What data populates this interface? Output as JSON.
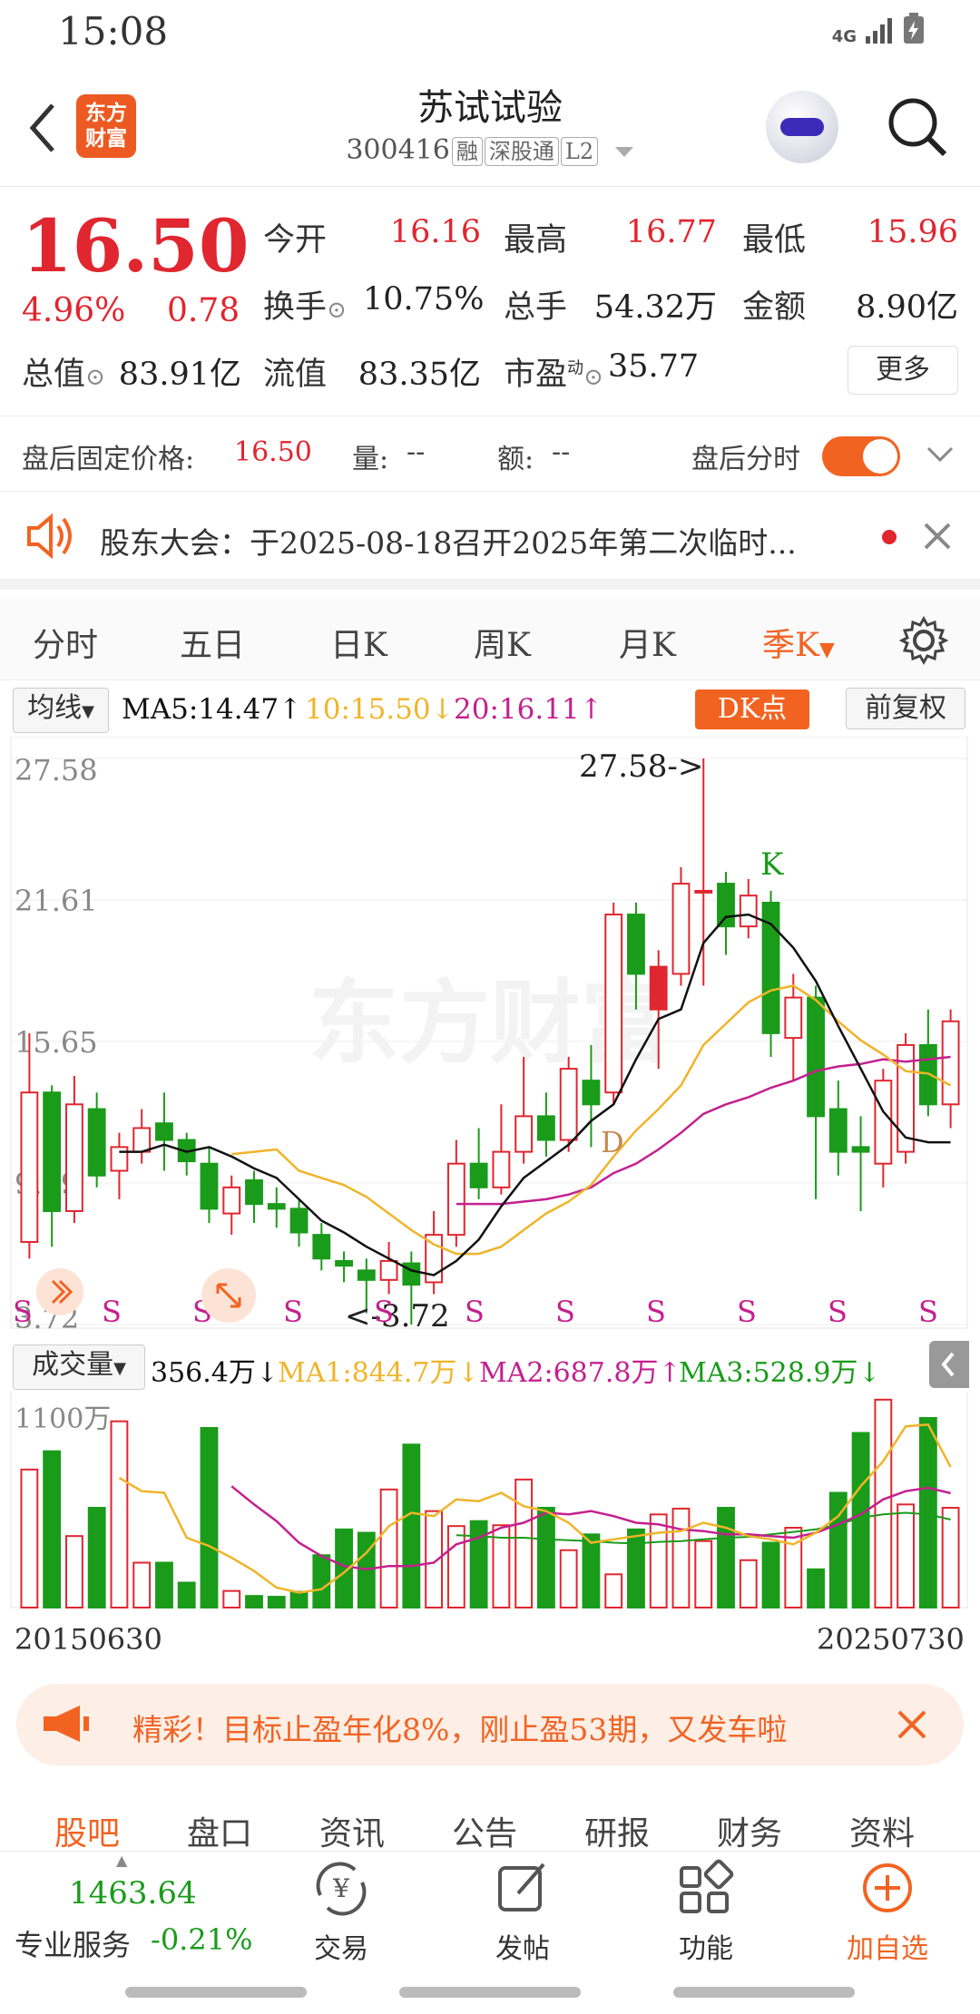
{
  "status": {
    "time": "15:08",
    "network": "4G"
  },
  "header": {
    "logo_text": "东方财富",
    "title": "苏试试验",
    "code": "300416",
    "tags": [
      "融",
      "深股通",
      "L2"
    ]
  },
  "quote": {
    "price": "16.50",
    "change_pct": "4.96%",
    "change": "0.78",
    "open_label": "今开",
    "open": "16.16",
    "high_label": "最高",
    "high": "16.77",
    "low_label": "最低",
    "low": "15.96",
    "turnover_label": "换手",
    "turnover": "10.75%",
    "volume_label": "总手",
    "volume": "54.32万",
    "amount_label": "金额",
    "amount": "8.90亿",
    "mcap_label": "总值",
    "mcap": "83.91亿",
    "float_label": "流值",
    "float": "83.35亿",
    "pe_label": "市盈",
    "pe_sup": "动",
    "pe": "35.77",
    "more_label": "更多"
  },
  "after_hours": {
    "label": "盘后固定价格:",
    "price": "16.50",
    "vol_label": "量:",
    "vol": "--",
    "amt_label": "额:",
    "amt": "--",
    "toggle_label": "盘后分时"
  },
  "notice": {
    "text": "股东大会：于2025-08-18召开2025年第二次临时..."
  },
  "tabs": [
    "分时",
    "五日",
    "日K",
    "周K",
    "月K",
    "季K"
  ],
  "active_tab": "季K",
  "ma_bar": {
    "selector": "均线",
    "ma5": "MA5:14.47↑",
    "ma10": "10:15.50↓",
    "ma20": "20:16.11↑",
    "dk": "DK点",
    "fq": "前复权"
  },
  "vol_bar": {
    "selector": "成交量",
    "vol": "356.4万↓",
    "ma1": "MA1:844.7万↓",
    "ma2": "MA2:687.8万↑",
    "ma3": "MA3:528.9万↓"
  },
  "colors": {
    "up": "#e0262f",
    "down": "#1a9b1a",
    "ma5": "#111111",
    "ma10": "#f0b429",
    "ma20": "#c4208f",
    "accent": "#f26322"
  },
  "chart_data": {
    "type": "candlestick",
    "period": "quarterly",
    "ylim": [
      3.72,
      27.58
    ],
    "y_ticks": [
      "27.58",
      "21.61",
      "15.65",
      "9.69",
      "3.72"
    ],
    "annotations": {
      "high": "27.58->",
      "low": "<-3.72",
      "markers": [
        "K",
        "D"
      ]
    },
    "signal_letter": "S",
    "volume_y_label": "1100万",
    "x_range_labels": [
      "20150630",
      "20250730"
    ],
    "candles": [
      [
        7.2,
        13.5,
        16.0,
        6.5
      ],
      [
        13.5,
        8.5,
        13.8,
        7.0
      ],
      [
        8.5,
        13.0,
        14.2,
        8.0
      ],
      [
        12.8,
        10.0,
        13.5,
        9.5
      ],
      [
        10.2,
        11.2,
        11.8,
        9.0
      ],
      [
        11.0,
        12.0,
        12.8,
        10.5
      ],
      [
        12.2,
        11.5,
        13.5,
        10.2
      ],
      [
        11.5,
        10.6,
        11.8,
        10.0
      ],
      [
        10.5,
        8.6,
        11.2,
        8.0
      ],
      [
        8.4,
        9.5,
        10.0,
        7.5
      ],
      [
        9.8,
        8.8,
        10.2,
        8.0
      ],
      [
        8.8,
        8.6,
        9.5,
        7.8
      ],
      [
        8.6,
        7.6,
        9.0,
        7.0
      ],
      [
        7.5,
        6.5,
        8.0,
        6.0
      ],
      [
        6.4,
        6.2,
        6.8,
        5.5
      ],
      [
        6.0,
        5.6,
        6.5,
        4.2
      ],
      [
        5.6,
        6.4,
        7.2,
        5.0
      ],
      [
        6.3,
        5.4,
        6.8,
        3.72
      ],
      [
        5.5,
        7.5,
        8.5,
        5.0
      ],
      [
        7.5,
        10.5,
        11.5,
        7.0
      ],
      [
        10.5,
        9.5,
        12.0,
        9.0
      ],
      [
        9.5,
        11.0,
        13.0,
        9.2
      ],
      [
        11.0,
        12.5,
        15.0,
        10.5
      ],
      [
        12.5,
        11.5,
        13.5,
        10.8
      ],
      [
        11.5,
        14.5,
        15.0,
        11.0
      ],
      [
        14.0,
        13.0,
        15.5,
        11.2
      ],
      [
        13.5,
        21.0,
        21.5,
        13.0
      ],
      [
        21.0,
        18.5,
        21.5,
        17.0
      ],
      [
        17.0,
        18.8,
        19.5,
        14.5
      ],
      [
        18.5,
        22.3,
        23.0,
        18.0
      ],
      [
        22.0,
        22.0,
        27.58,
        18.0
      ],
      [
        22.3,
        20.5,
        22.8,
        19.3
      ],
      [
        20.5,
        21.8,
        22.5,
        20.0
      ],
      [
        21.5,
        16.0,
        22.0,
        15.0
      ],
      [
        15.8,
        17.5,
        18.5,
        14.0
      ],
      [
        17.5,
        12.5,
        18.0,
        9.0
      ],
      [
        12.8,
        11.0,
        14.0,
        10.0
      ],
      [
        11.2,
        11.0,
        12.5,
        8.5
      ],
      [
        10.5,
        14.0,
        14.5,
        9.5
      ],
      [
        11.0,
        15.5,
        16.0,
        10.5
      ],
      [
        15.5,
        13.0,
        17.0,
        12.5
      ],
      [
        13.0,
        16.5,
        17.0,
        12.0
      ]
    ],
    "ma5": [
      null,
      null,
      null,
      null,
      11.0,
      11.0,
      11.3,
      11.0,
      11.2,
      10.8,
      10.3,
      9.9,
      9.0,
      8.1,
      7.6,
      7.0,
      6.5,
      6.0,
      5.8,
      6.4,
      7.3,
      8.7,
      9.9,
      10.6,
      11.3,
      12.3,
      13.0,
      14.9,
      16.6,
      17.0,
      19.8,
      20.9,
      21.0,
      20.6,
      19.6,
      18.2,
      16.3,
      14.5,
      12.7,
      11.6,
      11.4,
      11.4
    ],
    "ma10": [
      null,
      null,
      null,
      null,
      null,
      null,
      null,
      null,
      null,
      10.9,
      11.0,
      11.1,
      10.2,
      9.9,
      9.6,
      9.1,
      8.4,
      7.7,
      7.1,
      6.7,
      6.7,
      7.0,
      7.7,
      8.4,
      8.9,
      9.6,
      10.8,
      11.9,
      12.8,
      13.8,
      15.5,
      16.4,
      17.3,
      17.8,
      18.0,
      17.4,
      16.5,
      15.7,
      15.1,
      14.4,
      14.3,
      13.8
    ],
    "ma20": [
      null,
      null,
      null,
      null,
      null,
      null,
      null,
      null,
      null,
      null,
      null,
      null,
      null,
      null,
      null,
      null,
      null,
      null,
      null,
      8.8,
      8.8,
      8.8,
      8.9,
      9.0,
      9.2,
      9.5,
      10.1,
      10.5,
      11.1,
      11.8,
      12.6,
      13.0,
      13.3,
      13.7,
      14.0,
      14.4,
      14.6,
      14.7,
      14.9,
      14.8,
      14.9,
      15.0
    ],
    "volume": [
      830,
      940,
      430,
      600,
      1120,
      270,
      270,
      150,
      1080,
      100,
      70,
      65,
      95,
      315,
      470,
      450,
      710,
      980,
      580,
      490,
      520,
      495,
      770,
      600,
      345,
      440,
      200,
      470,
      560,
      595,
      400,
      600,
      285,
      390,
      480,
      230,
      690,
      1050,
      1250,
      620,
      1140,
      600
    ],
    "vol_ma1": [
      null,
      null,
      null,
      null,
      780,
      700,
      690,
      420,
      370,
      300,
      220,
      120,
      90,
      110,
      210,
      330,
      490,
      570,
      550,
      650,
      640,
      690,
      610,
      580,
      510,
      390,
      410,
      430,
      450,
      460,
      510,
      480,
      430,
      410,
      380,
      450,
      550,
      730,
      880,
      1090,
      1100,
      845
    ],
    "vol_ma2": [
      null,
      null,
      null,
      null,
      null,
      null,
      null,
      null,
      null,
      730,
      620,
      520,
      390,
      310,
      250,
      230,
      250,
      250,
      270,
      380,
      420,
      480,
      510,
      570,
      560,
      580,
      550,
      510,
      500,
      470,
      460,
      440,
      440,
      430,
      420,
      450,
      500,
      560,
      650,
      700,
      720,
      688
    ],
    "vol_ma3": [
      null,
      null,
      null,
      null,
      null,
      null,
      null,
      null,
      null,
      null,
      null,
      null,
      null,
      null,
      null,
      null,
      null,
      null,
      null,
      435,
      430,
      420,
      420,
      410,
      405,
      400,
      390,
      385,
      395,
      400,
      410,
      420,
      425,
      440,
      455,
      470,
      500,
      540,
      560,
      570,
      560,
      529
    ]
  },
  "banner": {
    "text": "精彩！目标止盈年化8%，刚止盈53期，又发车啦"
  },
  "bottom_tabs": [
    "股吧",
    "盘口",
    "资讯",
    "公告",
    "研报",
    "财务",
    "资料"
  ],
  "nav": {
    "index_value": "1463.64",
    "service_label": "专业服务",
    "index_change": "-0.21%",
    "trade": "交易",
    "post": "发帖",
    "func": "功能",
    "add": "加自选"
  }
}
